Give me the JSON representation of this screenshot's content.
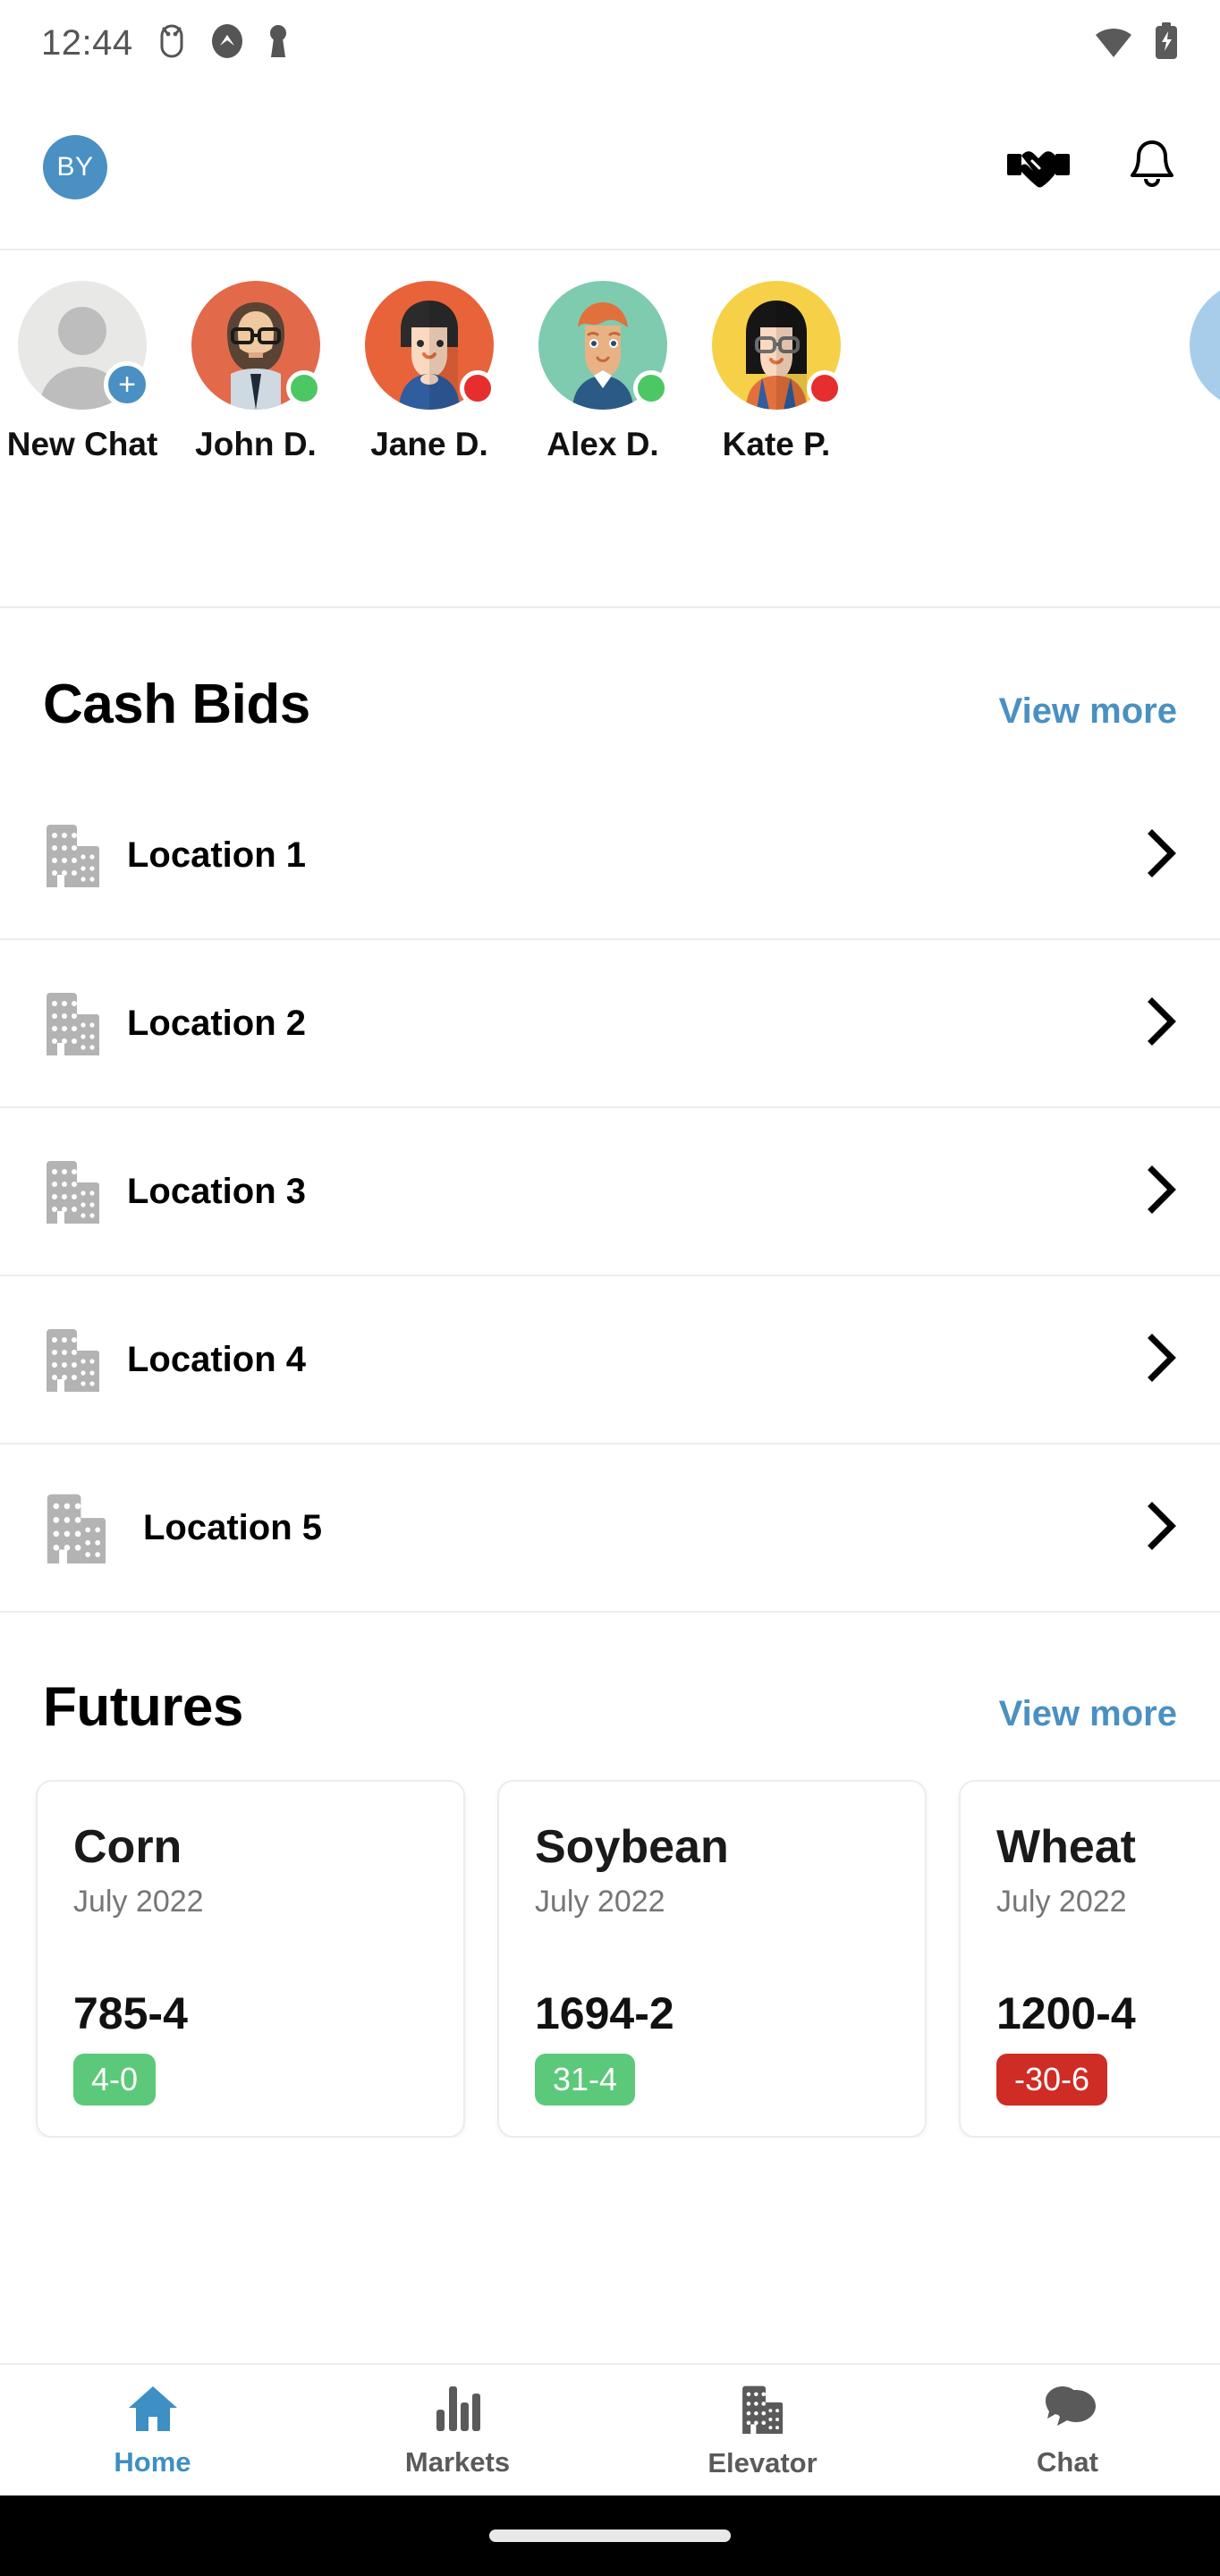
{
  "statusbar": {
    "time": "12:44",
    "icons": [
      "android-debug-icon",
      "app-badge-icon",
      "vpn-key-icon"
    ],
    "right_icons": [
      "wifi-icon",
      "battery-charging-icon"
    ]
  },
  "header": {
    "avatar_initials": "BY",
    "actions": [
      "handshake-icon",
      "bell-icon"
    ]
  },
  "chat_strip": {
    "items": [
      {
        "name": "New Chat",
        "type": "new",
        "bg": "#e8e8e6",
        "status": null
      },
      {
        "name": "John D.",
        "type": "person",
        "bg": "#e2694a",
        "status": "#4cc764"
      },
      {
        "name": "Jane D.",
        "type": "person",
        "bg": "#e8633a",
        "status": "#e62e2e"
      },
      {
        "name": "Alex D.",
        "type": "person",
        "bg": "#7ecbb0",
        "status": "#4cc764"
      },
      {
        "name": "Kate P.",
        "type": "person",
        "bg": "#f6d148",
        "status": "#e62e2e"
      }
    ]
  },
  "cash_bids": {
    "title": "Cash Bids",
    "view_more": "View more",
    "locations": [
      {
        "label": "Location 1"
      },
      {
        "label": "Location 2"
      },
      {
        "label": "Location 3"
      },
      {
        "label": "Location 4"
      },
      {
        "label": "Location 5"
      }
    ]
  },
  "futures": {
    "title": "Futures",
    "view_more": "View more",
    "cards": [
      {
        "commodity": "Corn",
        "month": "July 2022",
        "price": "785-4",
        "change": "4-0",
        "direction": "up",
        "badge_color": "#5cc97a"
      },
      {
        "commodity": "Soybean",
        "month": "July 2022",
        "price": "1694-2",
        "change": "31-4",
        "direction": "up",
        "badge_color": "#5cc97a"
      },
      {
        "commodity": "Wheat",
        "month": "July 2022",
        "price": "1200-4",
        "change": "-30-6",
        "direction": "down",
        "badge_color": "#cf2c25"
      }
    ]
  },
  "bottom_nav": {
    "items": [
      {
        "label": "Home",
        "icon": "home-icon",
        "active": true
      },
      {
        "label": "Markets",
        "icon": "bar-chart-icon",
        "active": false
      },
      {
        "label": "Elevator",
        "icon": "building-icon",
        "active": false
      },
      {
        "label": "Chat",
        "icon": "chat-bubble-icon",
        "active": false
      }
    ]
  },
  "colors": {
    "accent_blue": "#4a90c2",
    "positive_green": "#5cc97a",
    "negative_red": "#cf2c25",
    "text_primary": "#111111",
    "text_muted": "#767676"
  }
}
